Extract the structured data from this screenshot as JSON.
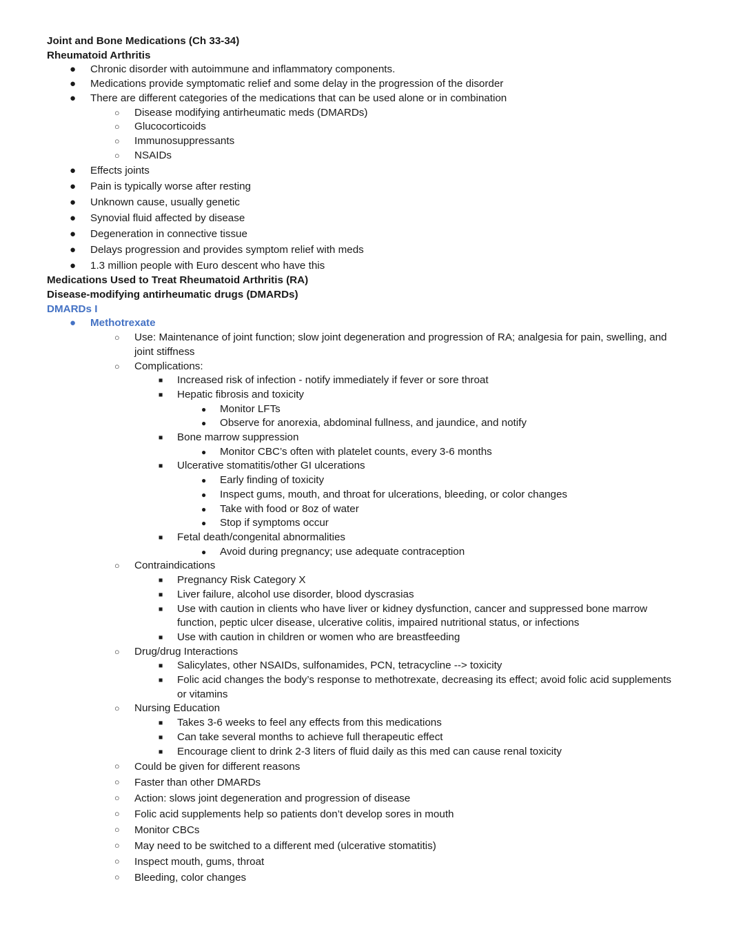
{
  "document": {
    "title": "Joint and Bone Medications (Ch 33-34)",
    "accent_color": "#4472C4",
    "text_color": "#1a1a1a",
    "background_color": "#ffffff",
    "markers": {
      "disc": "●",
      "circle": "○",
      "square": "■",
      "small_disc": "●"
    },
    "headings": {
      "h1": "Joint and Bone Medications (Ch 33-34)",
      "h2": "Rheumatoid Arthritis",
      "h3": "Medications Used to Treat Rheumatoid Arthritis (RA)",
      "h4": "Disease-modifying antirheumatic drugs (DMARDs)",
      "h5": "DMARDs I"
    },
    "ra_bullets_top": [
      "Chronic disorder with autoimmune and inflammatory components.",
      "Medications provide symptomatic relief and some delay in the progression of the disorder",
      "There are different categories of the medications that can be used alone or in combination"
    ],
    "ra_categories": [
      "Disease modifying antirheumatic meds (DMARDs)",
      "Glucocorticoids",
      "Immunosuppressants",
      "NSAIDs"
    ],
    "ra_bullets_bottom": [
      "Effects joints",
      "Pain is typically worse after resting",
      "Unknown cause, usually genetic",
      "Synovial fluid affected by disease",
      "Degeneration in connective tissue",
      "Delays progression and provides symptom relief with meds",
      "1.3 million people with Euro descent who have this"
    ],
    "methotrexate": {
      "label": "Methotrexate",
      "use_label": "Use: Maintenance of joint function; slow joint degeneration and progression of RA; analgesia for pain, swelling, and joint stiffness",
      "complications_label": "Complications:",
      "complications": [
        {
          "text": "Increased risk of infection - notify immediately if fever or sore throat",
          "sub": []
        },
        {
          "text": "Hepatic fibrosis and toxicity",
          "sub": [
            "Monitor LFTs",
            "Observe for anorexia, abdominal fullness, and jaundice, and notify"
          ]
        },
        {
          "text": "Bone marrow suppression",
          "sub": [
            "Monitor CBC’s often with platelet counts, every 3-6 months"
          ]
        },
        {
          "text": "Ulcerative stomatitis/other GI ulcerations",
          "sub": [
            "Early finding of toxicity",
            "Inspect gums, mouth, and throat for ulcerations, bleeding, or color changes",
            "Take with food or 8oz of water",
            "Stop if symptoms occur"
          ]
        },
        {
          "text": "Fetal death/congenital abnormalities",
          "sub": [
            "Avoid during pregnancy; use adequate contraception"
          ]
        }
      ],
      "contraindications_label": "Contraindications",
      "contraindications": [
        "Pregnancy Risk Category X",
        "Liver failure, alcohol use disorder, blood dyscrasias",
        "Use with caution in clients who have liver or kidney dysfunction, cancer and suppressed bone marrow function, peptic ulcer disease, ulcerative colitis, impaired nutritional status, or infections",
        "Use with caution in children or women who are breastfeeding"
      ],
      "interactions_label": "Drug/drug Interactions",
      "interactions": [
        "Salicylates, other NSAIDs, sulfonamides, PCN, tetracycline --> toxicity",
        "Folic acid changes the body’s response to methotrexate, decreasing its effect; avoid folic acid supplements or vitamins"
      ],
      "nursing_education_label": "Nursing Education",
      "nursing_education": [
        "Takes 3-6 weeks to feel any effects from this medications",
        "Can take several months to achieve full therapeutic effect",
        "Encourage client to drink 2-3 liters of fluid daily as this med can cause renal toxicity"
      ],
      "additional_notes": [
        "Could be given for different reasons",
        "Faster than other DMARDs",
        "Action: slows joint degeneration and progression of disease",
        "Folic acid supplements help so patients don’t develop sores in mouth",
        "Monitor CBCs",
        "May need to be switched to a different med (ulcerative stomatitis)",
        "Inspect mouth, gums, throat",
        "Bleeding, color changes"
      ]
    }
  }
}
